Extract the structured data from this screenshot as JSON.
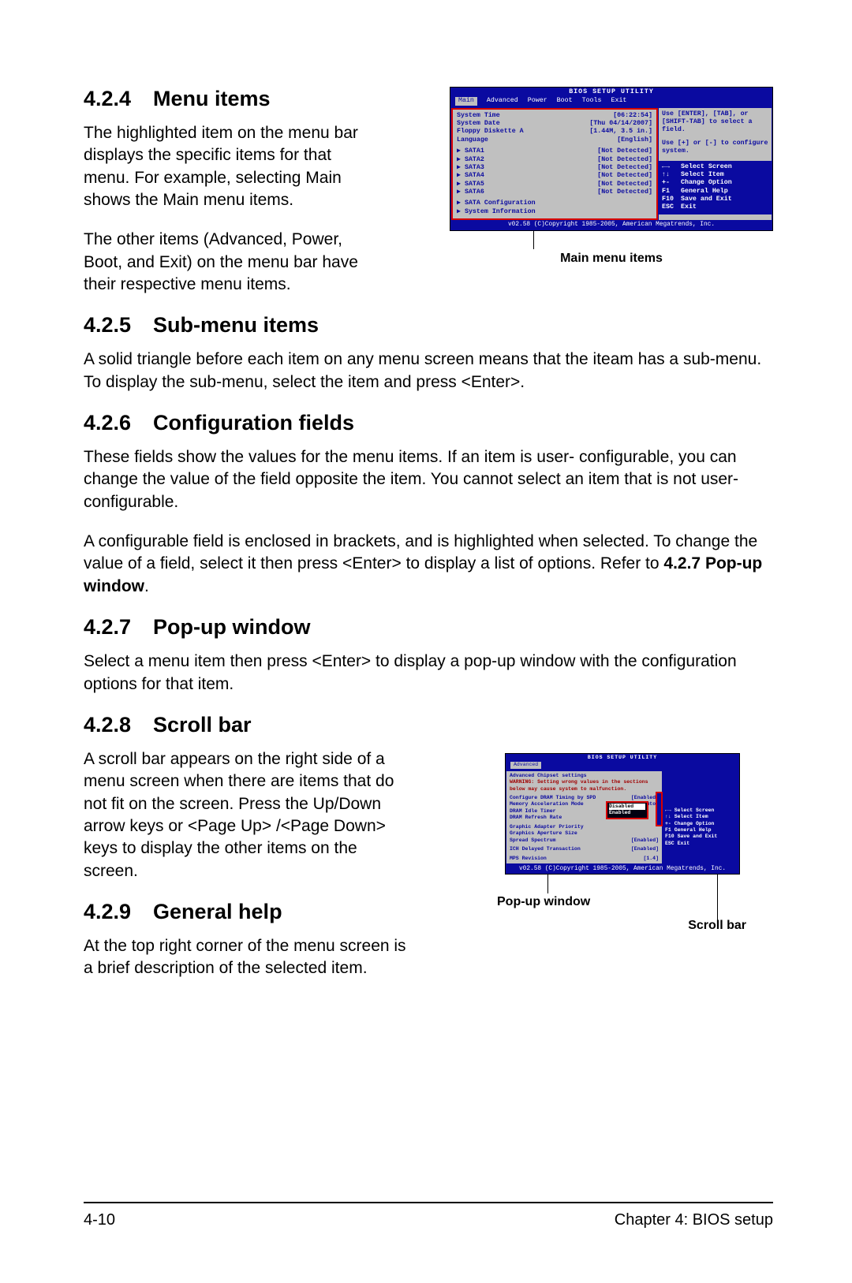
{
  "sections": {
    "s424": {
      "num": "4.2.4",
      "title": "Menu items"
    },
    "s425": {
      "num": "4.2.5",
      "title": "Sub-menu items"
    },
    "s426": {
      "num": "4.2.6",
      "title": "Configuration fields"
    },
    "s427": {
      "num": "4.2.7",
      "title": "Pop-up window"
    },
    "s428": {
      "num": "4.2.8",
      "title": "Scroll bar"
    },
    "s429": {
      "num": "4.2.9",
      "title": "General help"
    }
  },
  "text": {
    "p424a": "The highlighted item on the menu bar displays the specific items for that menu. For example, selecting Main shows the Main menu items.",
    "p424b": "The other items (Advanced, Power, Boot, and Exit) on the menu bar have their respective menu items.",
    "p425": "A solid triangle before each item on any menu screen means that the iteam has a sub-menu. To display the sub-menu, select the item and press <Enter>.",
    "p426a": "These fields show the values for the menu items. If an item is user- configurable, you can change the value of the field opposite the item. You cannot select an item that is not user-configurable.",
    "p426b_pre": "A configurable field is enclosed in brackets, and is highlighted when selected. To change the value of a field, select it then press <Enter> to display a list of options. Refer to ",
    "p426b_bold": "4.2.7 Pop-up window",
    "p426b_post": ".",
    "p427": "Select a menu item then press <Enter> to display a pop-up window with the configuration options for that item.",
    "p428": "A scroll bar appears on the right side of a menu screen when there are items that do not fit on the screen. Press the Up/Down arrow keys or <Page Up> /<Page Down> keys to display the other items on the screen.",
    "p429": "At the top right corner of the menu screen is a brief description of the selected item."
  },
  "bios1": {
    "title": "BIOS SETUP UTILITY",
    "tabs": [
      "Main",
      "Advanced",
      "Power",
      "Boot",
      "Tools",
      "Exit"
    ],
    "rows": [
      {
        "lbl": "System Time",
        "val": "[06:22:54]"
      },
      {
        "lbl": "System Date",
        "val": "[Thu 04/14/2007]"
      },
      {
        "lbl": "Floppy Diskette A",
        "val": "[1.44M, 3.5 in.]"
      },
      {
        "lbl": "Language",
        "val": "[English]"
      },
      {
        "lbl": "▶ SATA1",
        "val": "[Not Detected]"
      },
      {
        "lbl": "▶ SATA2",
        "val": "[Not Detected]"
      },
      {
        "lbl": "▶ SATA3",
        "val": "[Not Detected]"
      },
      {
        "lbl": "▶ SATA4",
        "val": "[Not Detected]"
      },
      {
        "lbl": "▶ SATA5",
        "val": "[Not Detected]"
      },
      {
        "lbl": "▶ SATA6",
        "val": "[Not Detected]"
      },
      {
        "lbl": "▶ SATA Configuration",
        "val": ""
      },
      {
        "lbl": "▶ System Information",
        "val": ""
      }
    ],
    "hints": [
      "Use [ENTER], [TAB], or [SHIFT-TAB] to select a field.",
      "Use [+] or [-] to configure system."
    ],
    "keys": [
      {
        "k": "←→",
        "d": "Select Screen"
      },
      {
        "k": "↑↓",
        "d": "Select Item"
      },
      {
        "k": "+-",
        "d": "Change Option"
      },
      {
        "k": "F1",
        "d": "General Help"
      },
      {
        "k": "F10",
        "d": "Save and Exit"
      },
      {
        "k": "ESC",
        "d": "Exit"
      }
    ],
    "footer": "v02.58 (C)Copyright 1985-2005, American Megatrends, Inc.",
    "caption": "Main menu items"
  },
  "bios2": {
    "title": "BIOS SETUP UTILITY",
    "tab": "Advanced",
    "heading": "Advanced Chipset settings",
    "warning": "WARNING: Setting wrong values in the sections below may cause system to malfunction.",
    "rows": [
      {
        "lbl": "Configure DRAM Timing by SPD",
        "val": "[Enabled]"
      },
      {
        "lbl": "Memory Acceleration Mode",
        "val": "[Auto]"
      },
      {
        "lbl": "DRAM Idle Timer",
        "val": ""
      },
      {
        "lbl": "DRAM Refresh Rate",
        "val": ""
      },
      {
        "lbl": "Graphic Adapter Priority",
        "val": ""
      },
      {
        "lbl": "Graphics Aperture Size",
        "val": ""
      },
      {
        "lbl": "Spread Spectrum",
        "val": "[Enabled]"
      },
      {
        "lbl": "ICH Delayed Transaction",
        "val": "[Enabled]"
      },
      {
        "lbl": "MPS Revision",
        "val": "[1.4]"
      }
    ],
    "popup": [
      "Disabled",
      "Enabled"
    ],
    "keys": [
      {
        "k": "←→",
        "d": "Select Screen"
      },
      {
        "k": "↑↓",
        "d": "Select Item"
      },
      {
        "k": "+-",
        "d": "Change Option"
      },
      {
        "k": "F1",
        "d": "General Help"
      },
      {
        "k": "F10",
        "d": "Save and Exit"
      },
      {
        "k": "ESC",
        "d": "Exit"
      }
    ],
    "footer": "v02.58 (C)Copyright 1985-2005, American Megatrends, Inc.",
    "caption_popup": "Pop-up window",
    "caption_scroll": "Scroll bar"
  },
  "footer": {
    "left": "4-10",
    "right": "Chapter 4: BIOS setup"
  }
}
